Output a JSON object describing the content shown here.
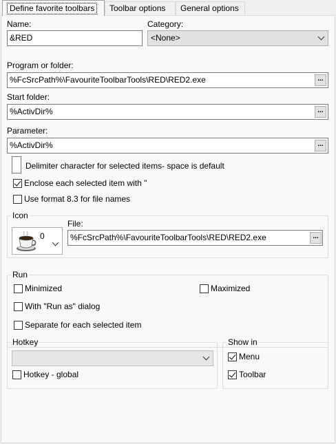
{
  "tabs": [
    {
      "label": "Define favorite toolbars"
    },
    {
      "label": "Toolbar options"
    },
    {
      "label": "General options"
    }
  ],
  "name": {
    "label": "Name:",
    "value": "&RED"
  },
  "category": {
    "label": "Category:",
    "value": "<None>"
  },
  "program": {
    "label": "Program or folder:",
    "value": "%FcSrcPath%\\FavouriteToolbarTools\\RED\\RED2.exe",
    "browse": "..."
  },
  "start_folder": {
    "label": "Start folder:",
    "value": "%ActivDir%",
    "browse": "..."
  },
  "parameter": {
    "label": "Parameter:",
    "value": "%ActivDir%",
    "browse": "..."
  },
  "options": {
    "delimiter": {
      "label": "Delimiter character for selected items- space is default",
      "value": ""
    },
    "enclose": {
      "label": "Enclose each selected item with \"",
      "checked": true
    },
    "format83": {
      "label": "Use format 8.3 for file names",
      "checked": false
    }
  },
  "icon": {
    "group_label": "Icon",
    "index": "0",
    "icon_name": "coffee-cup-icon",
    "file_label": "File:",
    "file_value": "%FcSrcPath%\\FavouriteToolbarTools\\RED\\RED2.exe",
    "browse": "..."
  },
  "run": {
    "group_label": "Run",
    "minimized": {
      "label": "Minimized",
      "checked": false
    },
    "maximized": {
      "label": "Maximized",
      "checked": false
    },
    "run_as": {
      "label": "With \"Run as\" dialog",
      "checked": false
    },
    "separate": {
      "label": "Separate for each selected item",
      "checked": false
    }
  },
  "hotkey": {
    "group_label": "Hotkey",
    "value": "",
    "global": {
      "label": "Hotkey - global",
      "checked": false
    }
  },
  "show_in": {
    "group_label": "Show in",
    "menu": {
      "label": "Menu",
      "checked": true
    },
    "toolbar": {
      "label": "Toolbar",
      "checked": true
    }
  }
}
